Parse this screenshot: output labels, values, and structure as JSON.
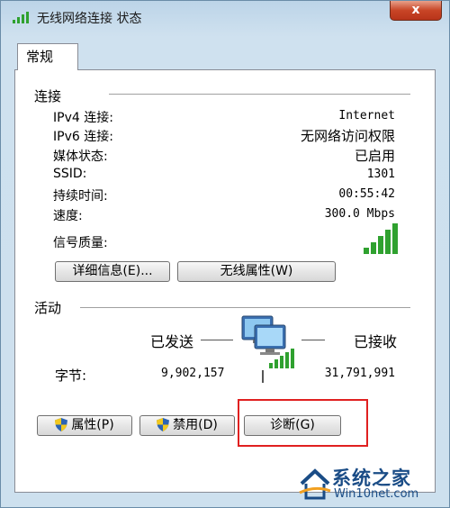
{
  "window": {
    "title": "无线网络连接 状态",
    "close_label": "x"
  },
  "tabs": [
    {
      "label": "常规"
    }
  ],
  "connection": {
    "section_title": "连接",
    "rows": [
      {
        "label": "IPv4 连接:",
        "value": "Internet"
      },
      {
        "label": "IPv6 连接:",
        "value": "无网络访问权限"
      },
      {
        "label": "媒体状态:",
        "value": "已启用"
      },
      {
        "label": "SSID:",
        "value": "1301"
      },
      {
        "label": "持续时间:",
        "value": "00:55:42"
      },
      {
        "label": "速度:",
        "value": "300.0 Mbps"
      }
    ],
    "signal_label": "信号质量:",
    "signal_bars": 5,
    "details_button": "详细信息(E)...",
    "wireless_props_button": "无线属性(W)"
  },
  "activity": {
    "section_title": "活动",
    "sent_label": "已发送",
    "received_label": "已接收",
    "bytes_label": "字节:",
    "bytes_sent": "9,902,157",
    "bytes_received": "31,791,991"
  },
  "buttons": {
    "properties": "属性(P)",
    "disable": "禁用(D)",
    "diagnose": "诊断(G)"
  },
  "watermark": {
    "title": "系统之家",
    "subtitle": "Win10net.com"
  },
  "colors": {
    "highlight_box": "#e02020",
    "signal_green": "#2fa12f",
    "watermark_blue": "#1a4c86"
  }
}
